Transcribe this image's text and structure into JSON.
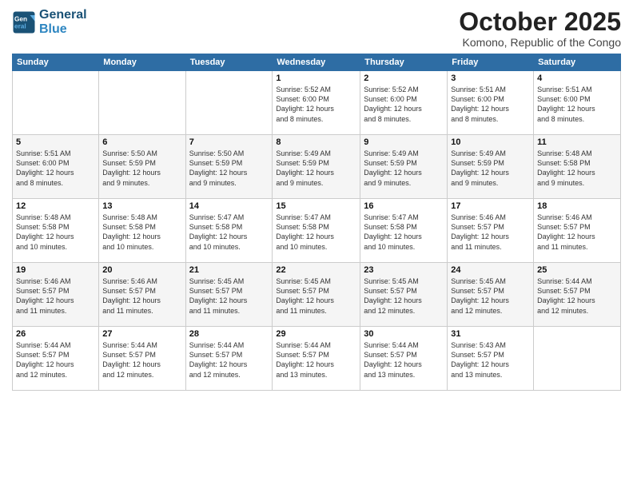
{
  "header": {
    "logo_line1": "General",
    "logo_line2": "Blue",
    "month": "October 2025",
    "location": "Komono, Republic of the Congo"
  },
  "days_of_week": [
    "Sunday",
    "Monday",
    "Tuesday",
    "Wednesday",
    "Thursday",
    "Friday",
    "Saturday"
  ],
  "weeks": [
    [
      {
        "day": "",
        "info": ""
      },
      {
        "day": "",
        "info": ""
      },
      {
        "day": "",
        "info": ""
      },
      {
        "day": "1",
        "info": "Sunrise: 5:52 AM\nSunset: 6:00 PM\nDaylight: 12 hours\nand 8 minutes."
      },
      {
        "day": "2",
        "info": "Sunrise: 5:52 AM\nSunset: 6:00 PM\nDaylight: 12 hours\nand 8 minutes."
      },
      {
        "day": "3",
        "info": "Sunrise: 5:51 AM\nSunset: 6:00 PM\nDaylight: 12 hours\nand 8 minutes."
      },
      {
        "day": "4",
        "info": "Sunrise: 5:51 AM\nSunset: 6:00 PM\nDaylight: 12 hours\nand 8 minutes."
      }
    ],
    [
      {
        "day": "5",
        "info": "Sunrise: 5:51 AM\nSunset: 6:00 PM\nDaylight: 12 hours\nand 8 minutes."
      },
      {
        "day": "6",
        "info": "Sunrise: 5:50 AM\nSunset: 5:59 PM\nDaylight: 12 hours\nand 9 minutes."
      },
      {
        "day": "7",
        "info": "Sunrise: 5:50 AM\nSunset: 5:59 PM\nDaylight: 12 hours\nand 9 minutes."
      },
      {
        "day": "8",
        "info": "Sunrise: 5:49 AM\nSunset: 5:59 PM\nDaylight: 12 hours\nand 9 minutes."
      },
      {
        "day": "9",
        "info": "Sunrise: 5:49 AM\nSunset: 5:59 PM\nDaylight: 12 hours\nand 9 minutes."
      },
      {
        "day": "10",
        "info": "Sunrise: 5:49 AM\nSunset: 5:59 PM\nDaylight: 12 hours\nand 9 minutes."
      },
      {
        "day": "11",
        "info": "Sunrise: 5:48 AM\nSunset: 5:58 PM\nDaylight: 12 hours\nand 9 minutes."
      }
    ],
    [
      {
        "day": "12",
        "info": "Sunrise: 5:48 AM\nSunset: 5:58 PM\nDaylight: 12 hours\nand 10 minutes."
      },
      {
        "day": "13",
        "info": "Sunrise: 5:48 AM\nSunset: 5:58 PM\nDaylight: 12 hours\nand 10 minutes."
      },
      {
        "day": "14",
        "info": "Sunrise: 5:47 AM\nSunset: 5:58 PM\nDaylight: 12 hours\nand 10 minutes."
      },
      {
        "day": "15",
        "info": "Sunrise: 5:47 AM\nSunset: 5:58 PM\nDaylight: 12 hours\nand 10 minutes."
      },
      {
        "day": "16",
        "info": "Sunrise: 5:47 AM\nSunset: 5:58 PM\nDaylight: 12 hours\nand 10 minutes."
      },
      {
        "day": "17",
        "info": "Sunrise: 5:46 AM\nSunset: 5:57 PM\nDaylight: 12 hours\nand 11 minutes."
      },
      {
        "day": "18",
        "info": "Sunrise: 5:46 AM\nSunset: 5:57 PM\nDaylight: 12 hours\nand 11 minutes."
      }
    ],
    [
      {
        "day": "19",
        "info": "Sunrise: 5:46 AM\nSunset: 5:57 PM\nDaylight: 12 hours\nand 11 minutes."
      },
      {
        "day": "20",
        "info": "Sunrise: 5:46 AM\nSunset: 5:57 PM\nDaylight: 12 hours\nand 11 minutes."
      },
      {
        "day": "21",
        "info": "Sunrise: 5:45 AM\nSunset: 5:57 PM\nDaylight: 12 hours\nand 11 minutes."
      },
      {
        "day": "22",
        "info": "Sunrise: 5:45 AM\nSunset: 5:57 PM\nDaylight: 12 hours\nand 11 minutes."
      },
      {
        "day": "23",
        "info": "Sunrise: 5:45 AM\nSunset: 5:57 PM\nDaylight: 12 hours\nand 12 minutes."
      },
      {
        "day": "24",
        "info": "Sunrise: 5:45 AM\nSunset: 5:57 PM\nDaylight: 12 hours\nand 12 minutes."
      },
      {
        "day": "25",
        "info": "Sunrise: 5:44 AM\nSunset: 5:57 PM\nDaylight: 12 hours\nand 12 minutes."
      }
    ],
    [
      {
        "day": "26",
        "info": "Sunrise: 5:44 AM\nSunset: 5:57 PM\nDaylight: 12 hours\nand 12 minutes."
      },
      {
        "day": "27",
        "info": "Sunrise: 5:44 AM\nSunset: 5:57 PM\nDaylight: 12 hours\nand 12 minutes."
      },
      {
        "day": "28",
        "info": "Sunrise: 5:44 AM\nSunset: 5:57 PM\nDaylight: 12 hours\nand 12 minutes."
      },
      {
        "day": "29",
        "info": "Sunrise: 5:44 AM\nSunset: 5:57 PM\nDaylight: 12 hours\nand 13 minutes."
      },
      {
        "day": "30",
        "info": "Sunrise: 5:44 AM\nSunset: 5:57 PM\nDaylight: 12 hours\nand 13 minutes."
      },
      {
        "day": "31",
        "info": "Sunrise: 5:43 AM\nSunset: 5:57 PM\nDaylight: 12 hours\nand 13 minutes."
      },
      {
        "day": "",
        "info": ""
      }
    ]
  ]
}
